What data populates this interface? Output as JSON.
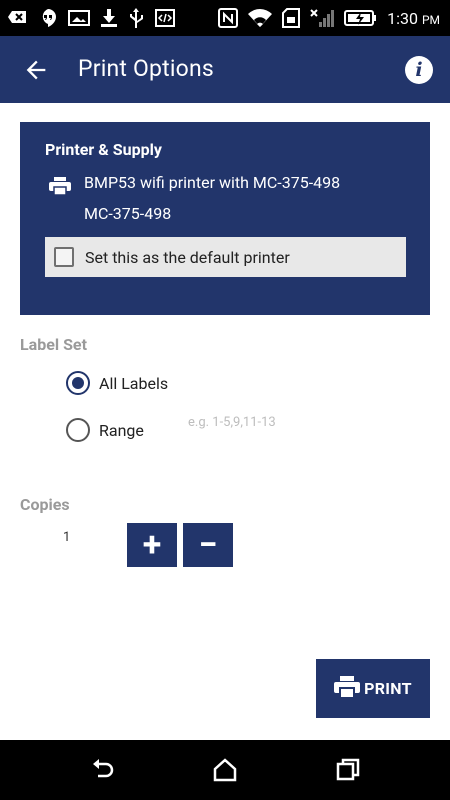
{
  "status_bar": {
    "time": "1:30",
    "ampm": "PM",
    "icons_left": [
      "message-icon",
      "hangouts-icon",
      "image-icon",
      "download-icon",
      "usb-icon",
      "code-icon"
    ],
    "icons_right": [
      "nfc-icon",
      "wifi-icon",
      "sd-card-icon",
      "no-signal-icon",
      "battery-icon"
    ]
  },
  "app_bar": {
    "title": "Print Options",
    "back_icon": "arrow-left-icon",
    "info_icon": "info-icon",
    "info_glyph": "i",
    "color": "#22356b"
  },
  "printer_supply": {
    "title": "Printer & Supply",
    "printer_name": "BMP53 wifi printer with MC-375-498",
    "supply": "MC-375-498",
    "default_label": "Set this as the default printer",
    "default_checked": false
  },
  "label_set": {
    "title": "Label Set",
    "options": [
      {
        "label": "All Labels",
        "checked": true
      },
      {
        "label": "Range",
        "checked": false
      }
    ],
    "range_placeholder": "e.g. 1-5,9,11-13"
  },
  "copies": {
    "title": "Copies",
    "value": "1",
    "plus": "+",
    "minus": "−"
  },
  "print_button": {
    "label": "PRINT"
  },
  "nav_bar": {
    "icons": [
      "back-nav-icon",
      "home-icon",
      "recents-icon"
    ]
  }
}
